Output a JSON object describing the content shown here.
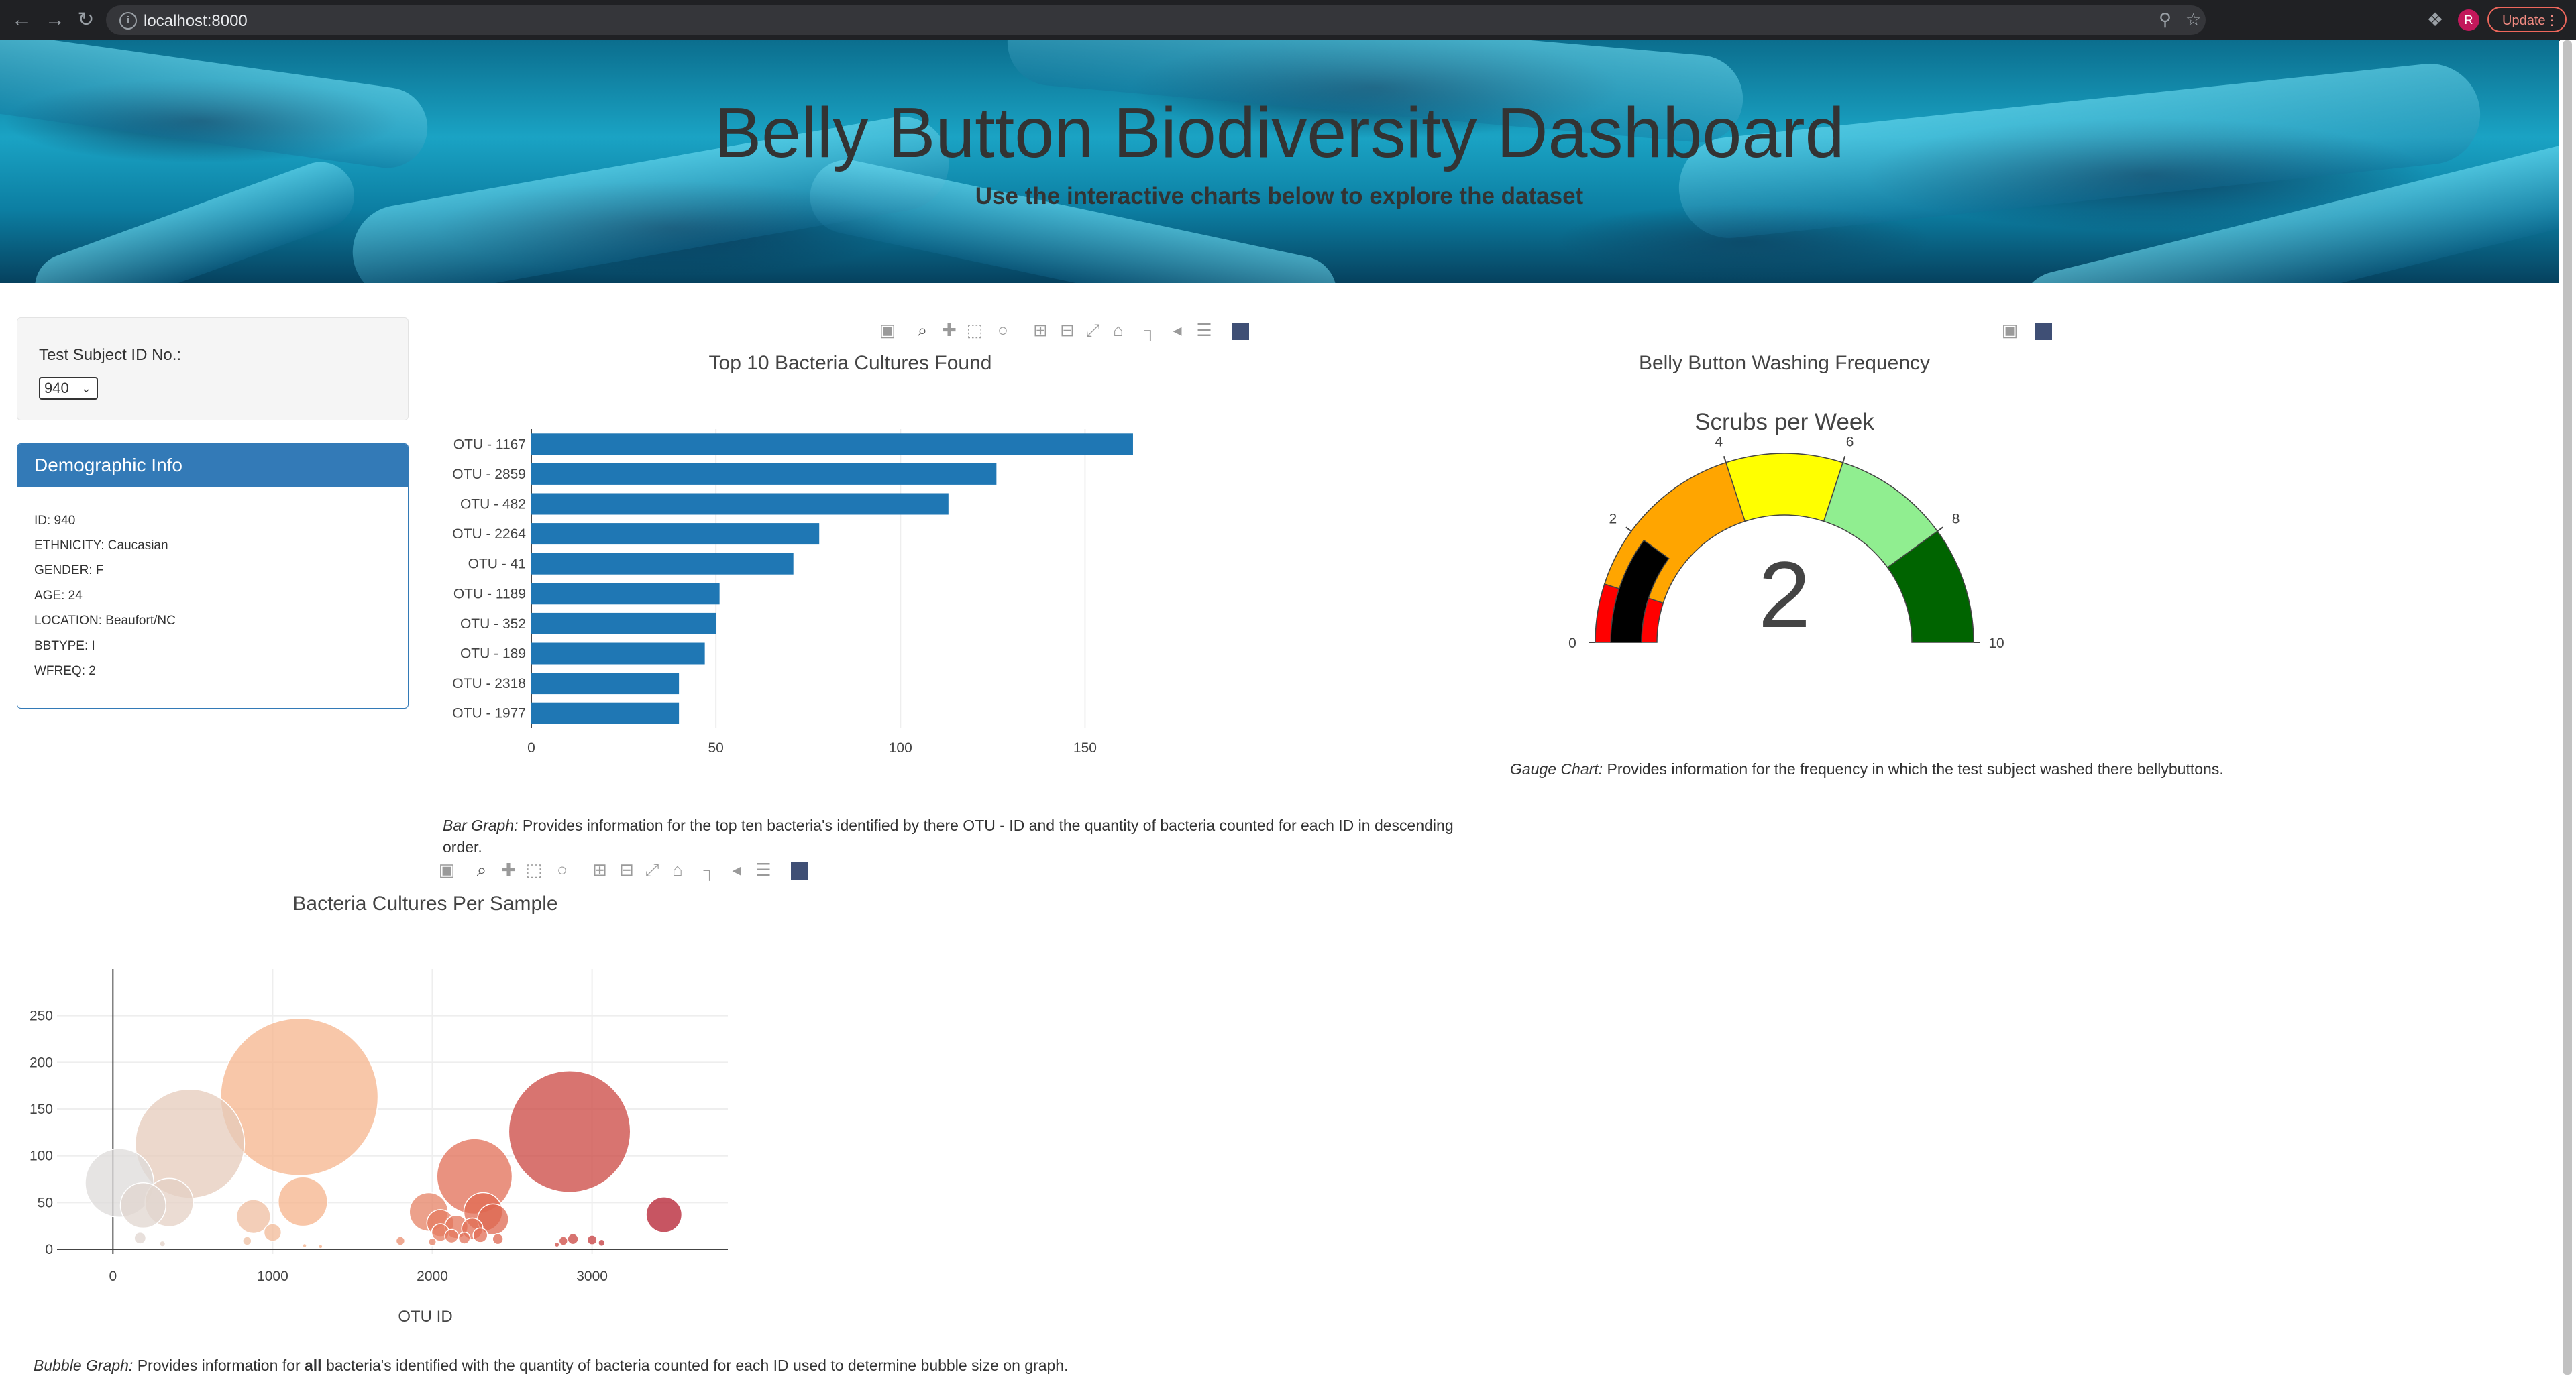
{
  "browser": {
    "url": "localhost:8000",
    "avatar_letter": "R",
    "update_label": "Update"
  },
  "hero": {
    "title": "Belly Button Biodiversity Dashboard",
    "subtitle": "Use the interactive charts below to explore the dataset"
  },
  "selector": {
    "label": "Test Subject ID No.:",
    "selected": "940"
  },
  "demographics": {
    "header": "Demographic Info",
    "lines": [
      "ID: 940",
      "ETHNICITY: Caucasian",
      "GENDER: F",
      "AGE: 24",
      "LOCATION: Beaufort/NC",
      "BBTYPE: I",
      "WFREQ: 2"
    ]
  },
  "captions": {
    "bar_label": "Bar Graph:",
    "bar_text": " Provides information for the top ten bacteria's identified by there OTU - ID and the quantity of bacteria counted for each ID in descending order.",
    "gauge_label": "Gauge Chart:",
    "gauge_text": " Provides information for the frequency in which the test subject washed there bellybuttons.",
    "bubble_label": "Bubble Graph:",
    "bubble_text_1": " Provides information for ",
    "bubble_bold": "all",
    "bubble_text_2": " bacteria's identified with the quantity of bacteria counted for each ID used to determine bubble size on graph."
  },
  "icons": {
    "modebar": [
      "camera-icon",
      "zoom-icon",
      "pan-icon",
      "box-select-icon",
      "lasso-select-icon",
      "zoom-in-icon",
      "zoom-out-icon",
      "autoscale-icon",
      "reset-axes-icon",
      "spike-lines-icon",
      "hover-closest-icon",
      "hover-compare-icon",
      "plotly-logo-icon"
    ]
  },
  "colors": {
    "bar": "#1f77b4",
    "demo_header": "#337ab7"
  },
  "chart_data": [
    {
      "type": "bar",
      "orientation": "horizontal",
      "title": "Top 10 Bacteria Cultures Found",
      "categories": [
        "OTU - 1167",
        "OTU - 2859",
        "OTU - 482",
        "OTU - 2264",
        "OTU - 41",
        "OTU - 1189",
        "OTU - 352",
        "OTU - 189",
        "OTU - 2318",
        "OTU - 1977"
      ],
      "values": [
        163,
        126,
        113,
        78,
        71,
        51,
        50,
        47,
        40,
        40
      ],
      "xlim": [
        0,
        175
      ],
      "xticks": [
        0,
        50,
        100,
        150
      ],
      "grid": true
    },
    {
      "type": "gauge",
      "title": "Belly Button Washing Frequency",
      "subtitle": "Scrubs per Week",
      "value": 2,
      "range": [
        0,
        10
      ],
      "tick_labels": [
        "0",
        "2",
        "4",
        "6",
        "8",
        "10"
      ],
      "steps": [
        {
          "range": [
            0,
            1
          ],
          "color": "#ff0000"
        },
        {
          "range": [
            1,
            4
          ],
          "color": "#ffa500"
        },
        {
          "range": [
            4,
            6
          ],
          "color": "#ffff00"
        },
        {
          "range": [
            6,
            8
          ],
          "color": "#90ee90"
        },
        {
          "range": [
            8,
            10
          ],
          "color": "#006400"
        }
      ],
      "bar_color": "#000000"
    },
    {
      "type": "scatter",
      "title": "Bacteria Cultures Per Sample",
      "xlabel": "OTU ID",
      "xticks": [
        0,
        1000,
        2000,
        3000
      ],
      "yticks": [
        0,
        50,
        100,
        150,
        200,
        250
      ],
      "xlim": [
        -350,
        3850
      ],
      "ylim": [
        -5,
        300
      ],
      "grid": true,
      "colorscale": [
        "#dcdcdc",
        "#f5b48c",
        "#e06a52",
        "#b2182b"
      ],
      "points": [
        {
          "x": 1167,
          "y": 163,
          "size": 163
        },
        {
          "x": 2859,
          "y": 126,
          "size": 126
        },
        {
          "x": 482,
          "y": 113,
          "size": 113
        },
        {
          "x": 2264,
          "y": 78,
          "size": 78
        },
        {
          "x": 41,
          "y": 71,
          "size": 71
        },
        {
          "x": 1189,
          "y": 51,
          "size": 51
        },
        {
          "x": 352,
          "y": 50,
          "size": 50
        },
        {
          "x": 189,
          "y": 47,
          "size": 47
        },
        {
          "x": 2318,
          "y": 40,
          "size": 40
        },
        {
          "x": 1977,
          "y": 40,
          "size": 40
        },
        {
          "x": 3450,
          "y": 37,
          "size": 37
        },
        {
          "x": 880,
          "y": 35,
          "size": 35
        },
        {
          "x": 2380,
          "y": 32,
          "size": 32
        },
        {
          "x": 2050,
          "y": 28,
          "size": 28
        },
        {
          "x": 2150,
          "y": 24,
          "size": 24
        },
        {
          "x": 2250,
          "y": 22,
          "size": 22
        },
        {
          "x": 2050,
          "y": 18,
          "size": 18
        },
        {
          "x": 1000,
          "y": 18,
          "size": 18
        },
        {
          "x": 2300,
          "y": 15,
          "size": 15
        },
        {
          "x": 2120,
          "y": 14,
          "size": 14
        },
        {
          "x": 2200,
          "y": 12,
          "size": 12
        },
        {
          "x": 2880,
          "y": 11,
          "size": 11
        },
        {
          "x": 2410,
          "y": 11,
          "size": 11
        },
        {
          "x": 170,
          "y": 12,
          "size": 12
        },
        {
          "x": 3000,
          "y": 10,
          "size": 10
        },
        {
          "x": 1800,
          "y": 9,
          "size": 9
        },
        {
          "x": 2820,
          "y": 9,
          "size": 9
        },
        {
          "x": 840,
          "y": 9,
          "size": 9
        },
        {
          "x": 2000,
          "y": 8,
          "size": 8
        },
        {
          "x": 3060,
          "y": 7,
          "size": 7
        },
        {
          "x": 310,
          "y": 6,
          "size": 6
        },
        {
          "x": 1200,
          "y": 4,
          "size": 4
        },
        {
          "x": 1300,
          "y": 3,
          "size": 3
        },
        {
          "x": 2780,
          "y": 5,
          "size": 5
        }
      ]
    }
  ]
}
